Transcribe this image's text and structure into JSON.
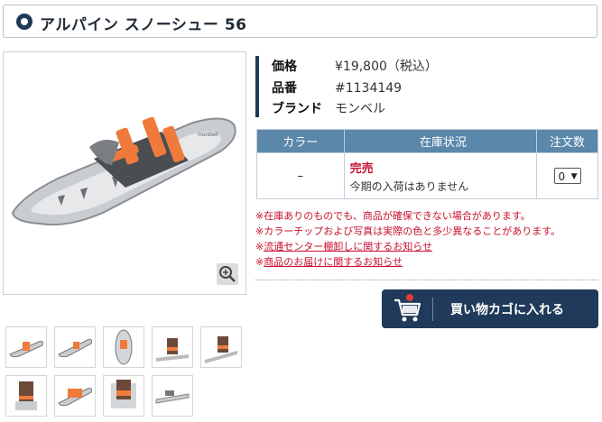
{
  "product": {
    "title": "アルパイン スノーシュー 56"
  },
  "spec": {
    "price_label": "価格",
    "price_value": "¥19,800（税込）",
    "sku_label": "品番",
    "sku_value": "#1134149",
    "brand_label": "ブランド",
    "brand_value": "モンベル"
  },
  "stock_table": {
    "headers": [
      "カラー",
      "在庫状況",
      "注文数"
    ],
    "rows": [
      {
        "color": "–",
        "status": "完売",
        "status_note": "今期の入荷はありません",
        "qty": "0"
      }
    ]
  },
  "notes": [
    "※在庫ありのものでも、商品が確保できない場合があります。",
    "※カラーチップおよび写真は実際の色と多少異なることがあります。",
    "※流通センター棚卸しに関するお知らせ",
    "※商品のお届けに関するお知らせ"
  ],
  "links": {
    "note_link_1": "流通センター棚卸しに関するお知らせ",
    "note_link_2": "商品のお届けに関するお知らせ"
  },
  "cart": {
    "label": "買い物カゴに入れる"
  },
  "colors": {
    "navy": "#1f3a5a",
    "header_blue": "#5b87ab",
    "alert_red": "#c8102e",
    "accent_orange": "#f07a3c"
  },
  "icons": {
    "title": "radio-dot-icon",
    "zoom": "zoom-in-icon",
    "cart": "cart-icon"
  }
}
